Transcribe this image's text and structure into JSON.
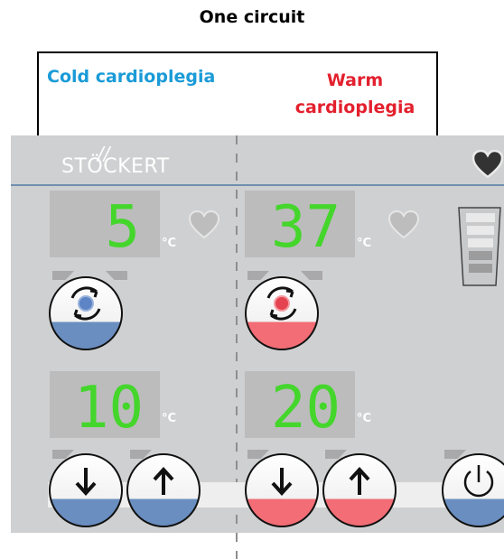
{
  "header": {
    "title": "One circuit"
  },
  "labels": {
    "cold": "Cold cardioplegia",
    "warm_line1": "Warm",
    "warm_line2": "cardioplegia"
  },
  "brand": {
    "logo": "STÖCKERT"
  },
  "cold": {
    "set_temp": "5",
    "set_unit": "°C",
    "bottom_temp": "10",
    "bottom_unit": "°C",
    "mode_icon": "rotate-blue-dot-icon",
    "accent_color": "#6a8ec0"
  },
  "warm": {
    "set_temp": "37",
    "set_unit": "°C",
    "bottom_temp": "20",
    "bottom_unit": "°C",
    "mode_icon": "rotate-red-dot-icon",
    "accent_color": "#f26d75"
  },
  "icons": {
    "heart_top": "heart-icon",
    "heart_small": "heart-outline-icon",
    "arrow_down": "arrow-down-icon",
    "arrow_up": "arrow-up-icon",
    "power": "power-icon",
    "level": "level-indicator-icon"
  },
  "colors": {
    "segment_green": "#45d62c",
    "panel_gray": "#cfd0d1",
    "blue": "#6a8ec0",
    "red": "#f26d75"
  }
}
